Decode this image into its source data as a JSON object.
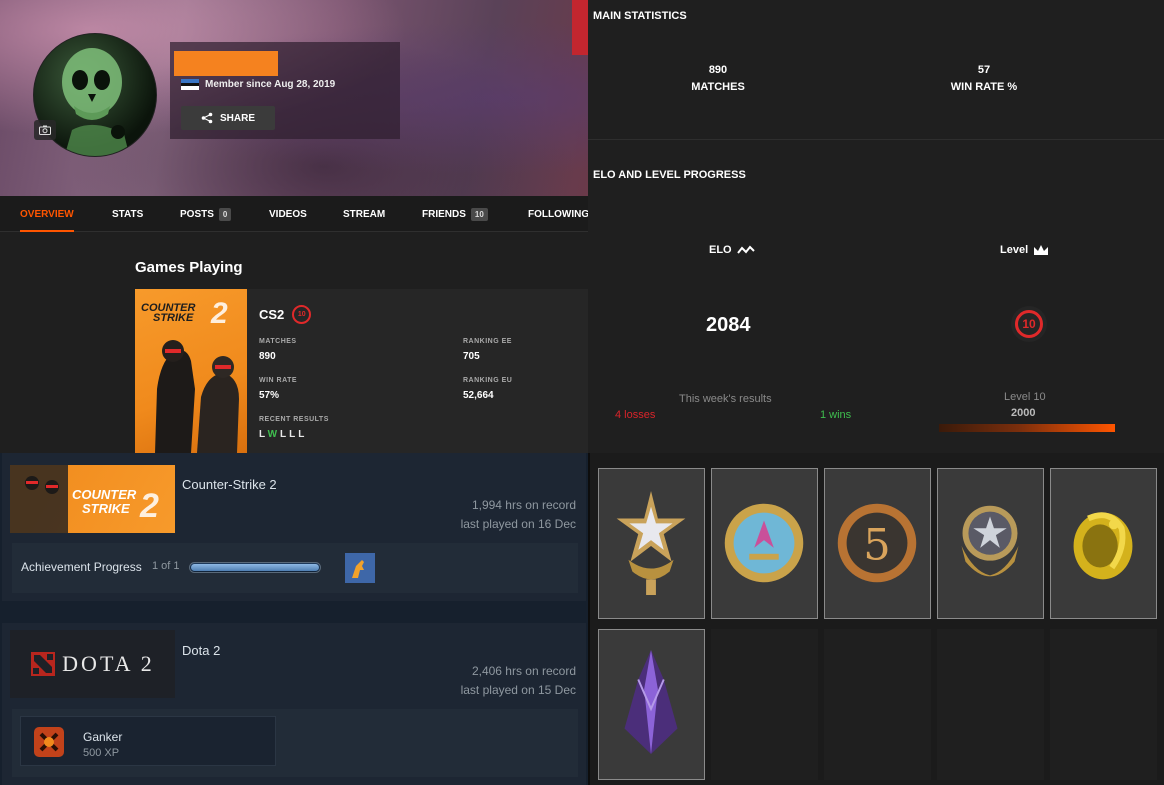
{
  "profile": {
    "member_since": "Member since Aug 28, 2019",
    "share_label": "SHARE",
    "nav": [
      {
        "label": "OVERVIEW",
        "active": true
      },
      {
        "label": "STATS"
      },
      {
        "label": "POSTS",
        "count": "0"
      },
      {
        "label": "VIDEOS"
      },
      {
        "label": "STREAM"
      },
      {
        "label": "FRIENDS",
        "count": "10"
      },
      {
        "label": "FOLLOWING"
      }
    ],
    "games_playing_title": "Games Playing",
    "game": {
      "cover_title_line1": "COUNTER",
      "cover_title_line2": "STRIKE",
      "cover_number": "2",
      "name": "CS2",
      "level": "10",
      "matches_label": "MATCHES",
      "matches_value": "890",
      "win_rate_label": "WIN RATE",
      "win_rate_value": "57%",
      "ranking_ee_label": "RANKING EE",
      "ranking_ee_value": "705",
      "ranking_eu_label": "RANKING EU",
      "ranking_eu_value": "52,664",
      "recent_results_label": "RECENT RESULTS",
      "recent_results": [
        "L",
        "W",
        "L",
        "L",
        "L"
      ]
    }
  },
  "stats": {
    "main_title": "MAIN STATISTICS",
    "matches_value": "890",
    "matches_label": "MATCHES",
    "win_rate_value": "57",
    "win_rate_label": "WIN RATE %",
    "elo_title": "ELO AND LEVEL PROGRESS",
    "elo_label": "ELO",
    "level_label": "Level",
    "elo_value": "2084",
    "level_value": "10",
    "week_results_label": "This week's results",
    "losses": "4 losses",
    "wins": "1 wins",
    "level_text": "Level 10",
    "level_points": "2000"
  },
  "steam": {
    "games": [
      {
        "name": "Counter-Strike 2",
        "hours": "1,994 hrs on record",
        "last_played": "last played on 16 Dec",
        "achievement_label": "Achievement Progress",
        "achievement_count": "1 of 1",
        "achievement_progress": 1.0
      },
      {
        "name": "Dota 2",
        "logo_text": "DOTA 2",
        "hours": "2,406 hrs on record",
        "last_played": "last played on 15 Dec",
        "badge_name": "Ganker",
        "badge_xp": "500 XP"
      }
    ]
  },
  "inventory": {
    "items": [
      "service-medal-star-icon",
      "counter-strike-coin-icon",
      "five-year-veteran-coin-icon",
      "global-offensive-badge-icon",
      "golden-dragon-pin-icon",
      "purple-crystal-charm-icon"
    ]
  },
  "colors": {
    "accent": "#ff5500",
    "loss": "#d9242a",
    "win": "#3fbf4f",
    "level_red": "#e0292a",
    "redaction": "#f5821f"
  }
}
